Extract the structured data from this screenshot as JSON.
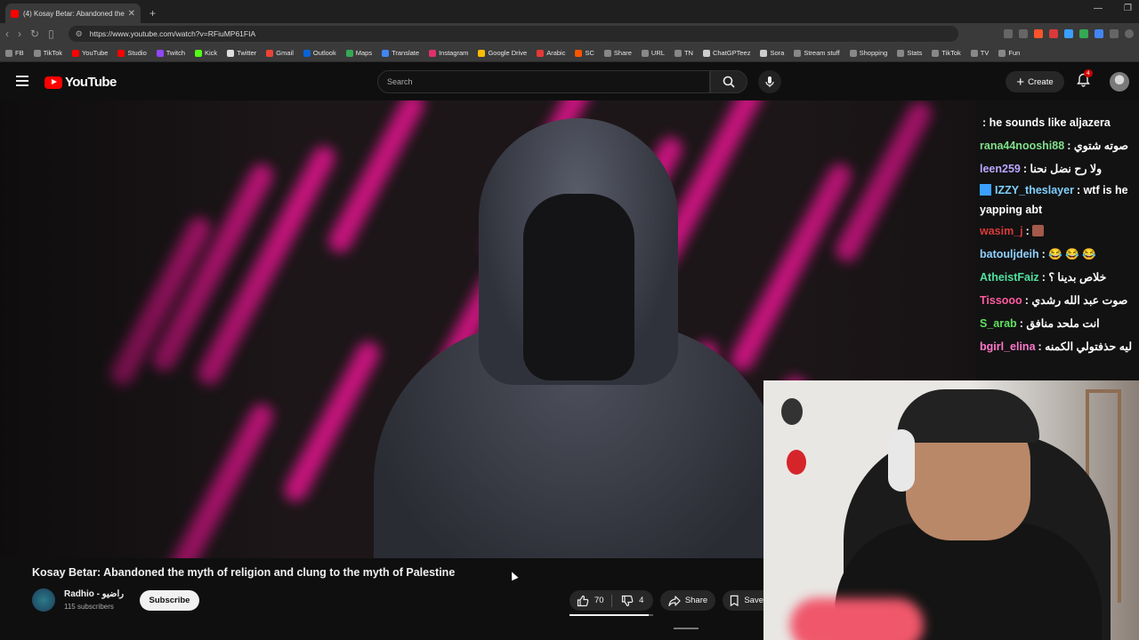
{
  "browser": {
    "tab_title": "(4) Kosay Betar: Abandoned the",
    "url": "https://www.youtube.com/watch?v=RFiuMP61FIA",
    "bookmarks": [
      {
        "label": "FB",
        "color": "#888888"
      },
      {
        "label": "TikTok",
        "color": "#888888"
      },
      {
        "label": "YouTube",
        "color": "#ff0000"
      },
      {
        "label": "Studio",
        "color": "#ff0000"
      },
      {
        "label": "Twitch",
        "color": "#9146ff"
      },
      {
        "label": "Kick",
        "color": "#53fc18"
      },
      {
        "label": "Twitter",
        "color": "#dddddd"
      },
      {
        "label": "Gmail",
        "color": "#ea4335"
      },
      {
        "label": "Outlook",
        "color": "#0a64d6"
      },
      {
        "label": "Maps",
        "color": "#34a853"
      },
      {
        "label": "Translate",
        "color": "#4285f4"
      },
      {
        "label": "Instagram",
        "color": "#e1306c"
      },
      {
        "label": "Google Drive",
        "color": "#fbbc04"
      },
      {
        "label": "Arabic",
        "color": "#e53935"
      },
      {
        "label": "SC",
        "color": "#ff5500"
      },
      {
        "label": "Share",
        "color": "#888888"
      },
      {
        "label": "URL",
        "color": "#888888"
      },
      {
        "label": "TN",
        "color": "#888888"
      },
      {
        "label": "ChatGPTeez",
        "color": "#cccccc"
      },
      {
        "label": "Sora",
        "color": "#cccccc"
      },
      {
        "label": "Stream stuff",
        "color": "#888888"
      },
      {
        "label": "Shopping",
        "color": "#888888"
      },
      {
        "label": "Stats",
        "color": "#888888"
      },
      {
        "label": "TikTok",
        "color": "#888888"
      },
      {
        "label": "TV",
        "color": "#888888"
      },
      {
        "label": "Fun",
        "color": "#888888"
      }
    ]
  },
  "youtube": {
    "logo_text": "YouTube",
    "search_placeholder": "Search",
    "create_label": "Create",
    "notification_count": "4"
  },
  "video": {
    "title": "Kosay Betar: Abandoned the myth of religion and clung to the myth of Palestine",
    "channel_name": "Radhio - راضيو",
    "subscribers": "115 subscribers",
    "subscribe_label": "Subscribe",
    "likes": "70",
    "dislikes": "4",
    "like_ratio": 0.95,
    "share_label": "Share",
    "save_label": "Save"
  },
  "chat": [
    {
      "user": "",
      "user_color": "#ffffff",
      "text": ": he sounds like aljazera"
    },
    {
      "user": "rana44nooshi88",
      "user_color": "#7fe08a",
      "text": ": صوته شتوي"
    },
    {
      "user": "leen259",
      "user_color": "#b9a6ff",
      "text": ": ولا رح نضل نحنا"
    },
    {
      "user": "IZZY_theslayer",
      "user_color": "#7fd0ff",
      "text": ": wtf is he yapping abt"
    },
    {
      "user": "wasim_j",
      "user_color": "#d83a3a",
      "text": ":"
    },
    {
      "user": "batouljdeih",
      "user_color": "#8fd0ff",
      "text": ": 😂 😂 😂"
    },
    {
      "user": "AtheistFaiz",
      "user_color": "#50e0a0",
      "text": ": خلاص بدينا ؟"
    },
    {
      "user": "Tissooo",
      "user_color": "#ff5aa0",
      "text": ": صوت عبد الله رشدي"
    },
    {
      "user": "S_arab",
      "user_color": "#60e060",
      "text": ": انت ملحد منافق"
    },
    {
      "user": "bgirl_elina",
      "user_color": "#ff77cc",
      "text": ": ليه حذفتولي الكمنه"
    }
  ]
}
